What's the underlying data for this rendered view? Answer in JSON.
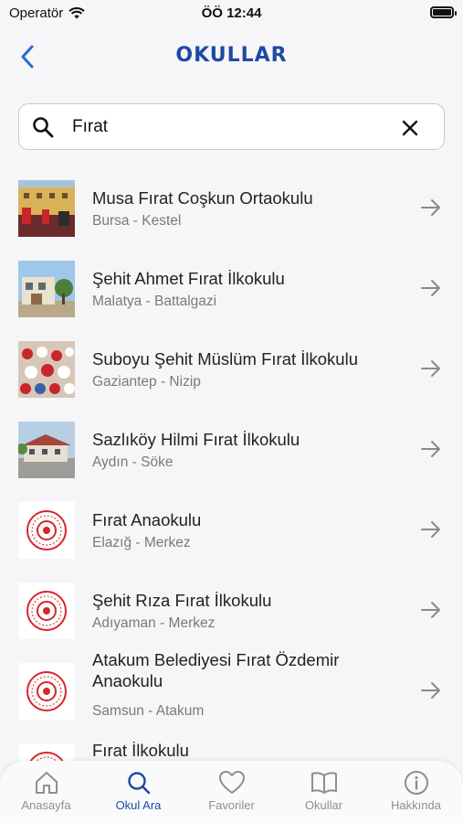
{
  "status_bar": {
    "carrier": "Operatör",
    "time": "ÖÖ 12:44"
  },
  "nav": {
    "title": "OKULLAR",
    "back_icon": "chevron-left-icon"
  },
  "search": {
    "value": "Fırat",
    "placeholder": "",
    "icon": "search-icon",
    "clear_icon": "close-icon"
  },
  "colors": {
    "accent": "#1f4aa3",
    "title": "#1f4aa3",
    "secondary_text": "#7a7a7e",
    "logo_red": "#d9252b"
  },
  "results": [
    {
      "name": "Musa Fırat Coşkun Ortaokulu",
      "location": "Bursa - Kestel",
      "thumb": "photo-school-ceremony"
    },
    {
      "name": "Şehit Ahmet Fırat İlkokulu",
      "location": "Malatya - Battalgazi",
      "thumb": "photo-school-building"
    },
    {
      "name": "Suboyu Şehit Müslüm Fırat İlkokulu",
      "location": "Gaziantep - Nizip",
      "thumb": "photo-students"
    },
    {
      "name": "Sazlıköy Hilmi Fırat İlkokulu",
      "location": "Aydın - Söke",
      "thumb": "photo-school-yard"
    },
    {
      "name": "Fırat Anaokulu",
      "location": "Elazığ - Merkez",
      "thumb": "meb-logo"
    },
    {
      "name": "Şehit Rıza Fırat İlkokulu",
      "location": "Adıyaman - Merkez",
      "thumb": "meb-logo"
    },
    {
      "name": "Atakum Belediyesi Fırat Özdemir Anaokulu",
      "location": "Samsun - Atakum",
      "thumb": "meb-logo"
    },
    {
      "name": "Fırat İlkokulu",
      "location": "",
      "thumb": "meb-logo"
    }
  ],
  "tabs": [
    {
      "label": "Anasayfa",
      "icon": "home-icon",
      "active": false
    },
    {
      "label": "Okul Ara",
      "icon": "search-icon",
      "active": true
    },
    {
      "label": "Favoriler",
      "icon": "heart-icon",
      "active": false
    },
    {
      "label": "Okullar",
      "icon": "book-icon",
      "active": false
    },
    {
      "label": "Hakkında",
      "icon": "info-icon",
      "active": false
    }
  ]
}
